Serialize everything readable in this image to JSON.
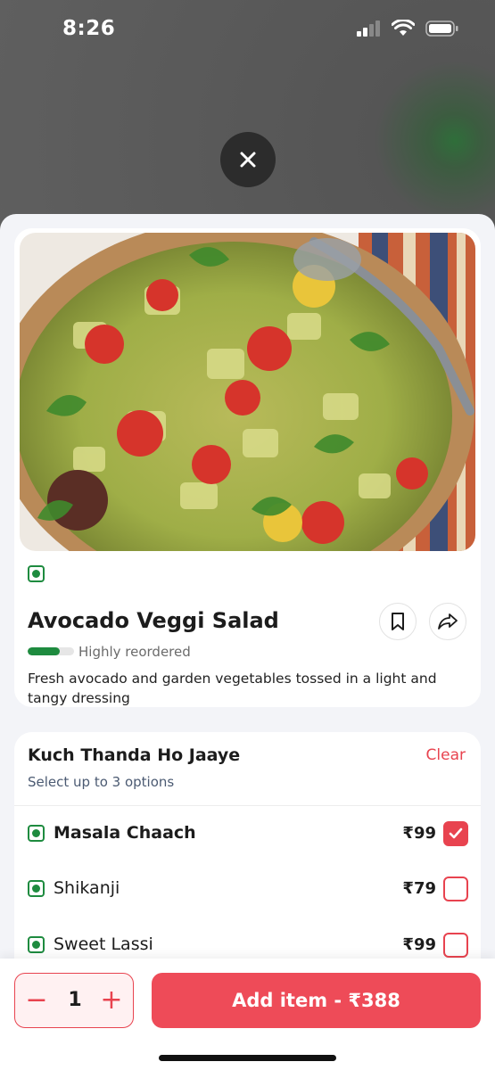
{
  "status_bar": {
    "time": "8:26"
  },
  "item": {
    "title": "Avocado Veggi Salad",
    "reorder_label": "Highly reordered",
    "reorder_level": 0.7,
    "description": "Fresh avocado and garden vegetables tossed in a light and tangy dressing"
  },
  "options": {
    "title": "Kuch Thanda Ho Jaaye",
    "subtitle": "Select up to 3 options",
    "clear_label": "Clear",
    "items": [
      {
        "name": "Masala Chaach",
        "price": "₹99",
        "checked": true
      },
      {
        "name": "Shikanji",
        "price": "₹79",
        "checked": false
      },
      {
        "name": "Sweet Lassi",
        "price": "₹99",
        "checked": false
      }
    ]
  },
  "cart": {
    "quantity": "1",
    "minus_label": "−",
    "plus_label": "+",
    "add_label": "Add item - ₹388"
  },
  "colors": {
    "accent": "#ee4b58",
    "veg": "#1e8b3f"
  }
}
